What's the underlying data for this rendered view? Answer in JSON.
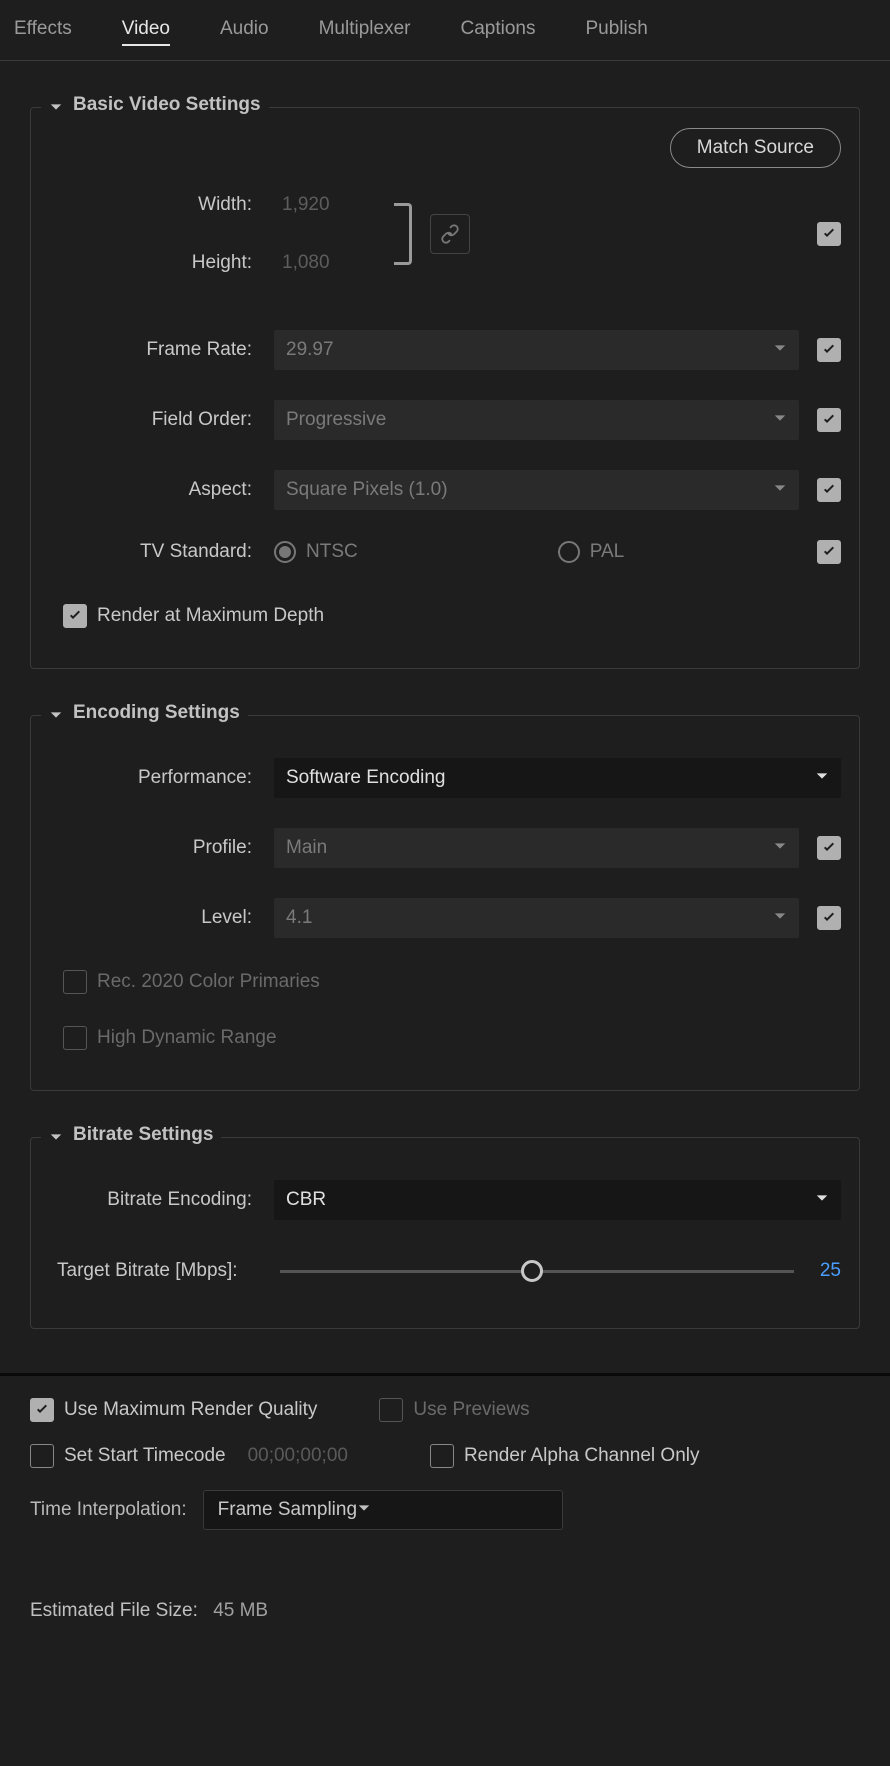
{
  "tabs": {
    "effects": "Effects",
    "video": "Video",
    "audio": "Audio",
    "multiplexer": "Multiplexer",
    "captions": "Captions",
    "publish": "Publish"
  },
  "basic": {
    "title": "Basic Video Settings",
    "match_source": "Match Source",
    "width_label": "Width:",
    "width_value": "1,920",
    "height_label": "Height:",
    "height_value": "1,080",
    "frame_rate_label": "Frame Rate:",
    "frame_rate_value": "29.97",
    "field_order_label": "Field Order:",
    "field_order_value": "Progressive",
    "aspect_label": "Aspect:",
    "aspect_value": "Square Pixels (1.0)",
    "tv_standard_label": "TV Standard:",
    "ntsc": "NTSC",
    "pal": "PAL",
    "render_max_depth": "Render at Maximum Depth"
  },
  "encoding": {
    "title": "Encoding Settings",
    "performance_label": "Performance:",
    "performance_value": "Software Encoding",
    "profile_label": "Profile:",
    "profile_value": "Main",
    "level_label": "Level:",
    "level_value": "4.1",
    "rec2020": "Rec. 2020 Color Primaries",
    "hdr": "High Dynamic Range"
  },
  "bitrate": {
    "title": "Bitrate Settings",
    "encoding_label": "Bitrate Encoding:",
    "encoding_value": "CBR",
    "target_label": "Target Bitrate [Mbps]:",
    "target_value": "25",
    "target_percent": 49
  },
  "bottom": {
    "use_max_quality": "Use Maximum Render Quality",
    "use_previews": "Use Previews",
    "set_start_timecode": "Set Start Timecode",
    "timecode": "00;00;00;00",
    "render_alpha": "Render Alpha Channel Only",
    "time_interp_label": "Time Interpolation:",
    "time_interp_value": "Frame Sampling",
    "est_file_size_label": "Estimated File Size:",
    "est_file_size_value": "45 MB"
  }
}
